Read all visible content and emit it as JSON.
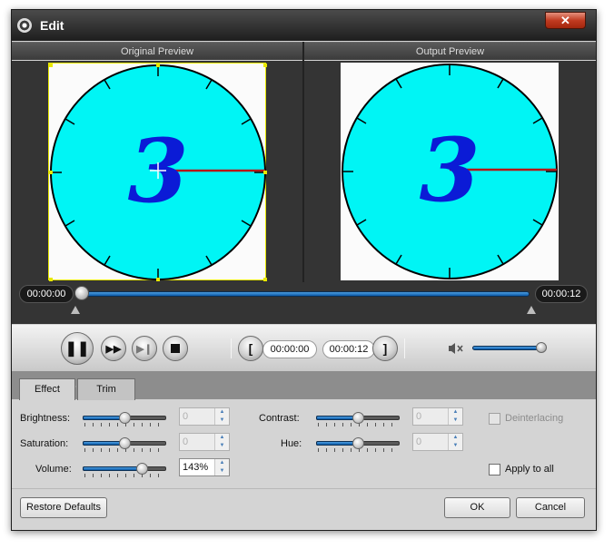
{
  "window": {
    "title": "Edit",
    "close_glyph": "✕"
  },
  "preview": {
    "original_label": "Original Preview",
    "output_label": "Output Preview",
    "clock_digit": "3"
  },
  "timeline": {
    "start_time": "00:00:00",
    "end_time": "00:00:12",
    "position": 0.0
  },
  "controls": {
    "pause_icon": "pause-icon",
    "forward_icon": "fast-forward-icon",
    "step_icon": "step-frame-icon",
    "stop_icon": "stop-icon",
    "trim_start_time": "00:00:00",
    "trim_end_time": "00:00:12",
    "volume_level": 0.92
  },
  "tabs": [
    {
      "label": "Effect",
      "active": true
    },
    {
      "label": "Trim",
      "active": false
    }
  ],
  "effect": {
    "brightness": {
      "label": "Brightness:",
      "value": "0",
      "level": 0.5
    },
    "saturation": {
      "label": "Saturation:",
      "value": "0",
      "level": 0.5
    },
    "volume": {
      "label": "Volume:",
      "value": "143%",
      "level": 0.72
    },
    "contrast": {
      "label": "Contrast:",
      "value": "0",
      "level": 0.5
    },
    "hue": {
      "label": "Hue:",
      "value": "0",
      "level": 0.5
    },
    "deinterlacing": {
      "label": "Deinterlacing",
      "checked": false,
      "enabled": false
    },
    "apply_to_all": {
      "label": "Apply to all",
      "checked": false
    }
  },
  "buttons": {
    "restore": "Restore Defaults",
    "ok": "OK",
    "cancel": "Cancel"
  },
  "colors": {
    "accent": "#0b5aa8",
    "clock_face": "#00f5f5",
    "digit": "#0b1bd6",
    "hand": "#b41818"
  }
}
